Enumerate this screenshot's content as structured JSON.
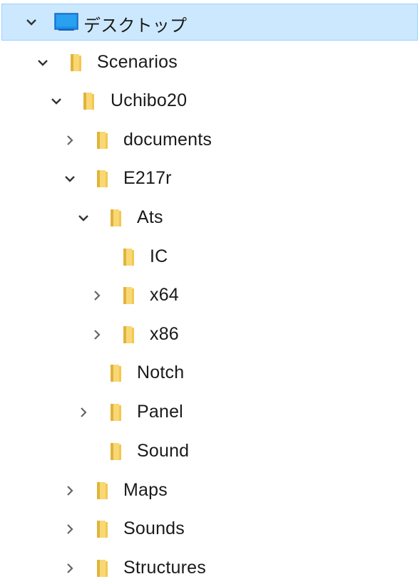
{
  "tree": {
    "items": [
      {
        "label": "デスクトップ",
        "expanded": true,
        "icon": "desktop-icon",
        "selected": true
      },
      {
        "label": "Scenarios",
        "expanded": true,
        "icon": "folder-icon"
      },
      {
        "label": "Uchibo20",
        "expanded": true,
        "icon": "folder-icon"
      },
      {
        "label": "documents",
        "expanded": false,
        "icon": "folder-icon"
      },
      {
        "label": "E217r",
        "expanded": true,
        "icon": "folder-icon"
      },
      {
        "label": "Ats",
        "expanded": true,
        "icon": "folder-icon"
      },
      {
        "label": "IC",
        "expanded": null,
        "icon": "folder-icon"
      },
      {
        "label": "x64",
        "expanded": false,
        "icon": "folder-icon"
      },
      {
        "label": "x86",
        "expanded": false,
        "icon": "folder-icon"
      },
      {
        "label": "Notch",
        "expanded": null,
        "icon": "folder-icon"
      },
      {
        "label": "Panel",
        "expanded": false,
        "icon": "folder-icon"
      },
      {
        "label": "Sound",
        "expanded": null,
        "icon": "folder-icon"
      },
      {
        "label": "Maps",
        "expanded": false,
        "icon": "folder-icon"
      },
      {
        "label": "Sounds",
        "expanded": false,
        "icon": "folder-icon"
      },
      {
        "label": "Structures",
        "expanded": false,
        "icon": "folder-icon"
      }
    ]
  },
  "colors": {
    "selection_bg": "#cce8ff",
    "selection_border": "#99d1ff",
    "folder_yellow": "#f8d775",
    "folder_dark": "#e0b33a",
    "chevron": "#333333"
  }
}
